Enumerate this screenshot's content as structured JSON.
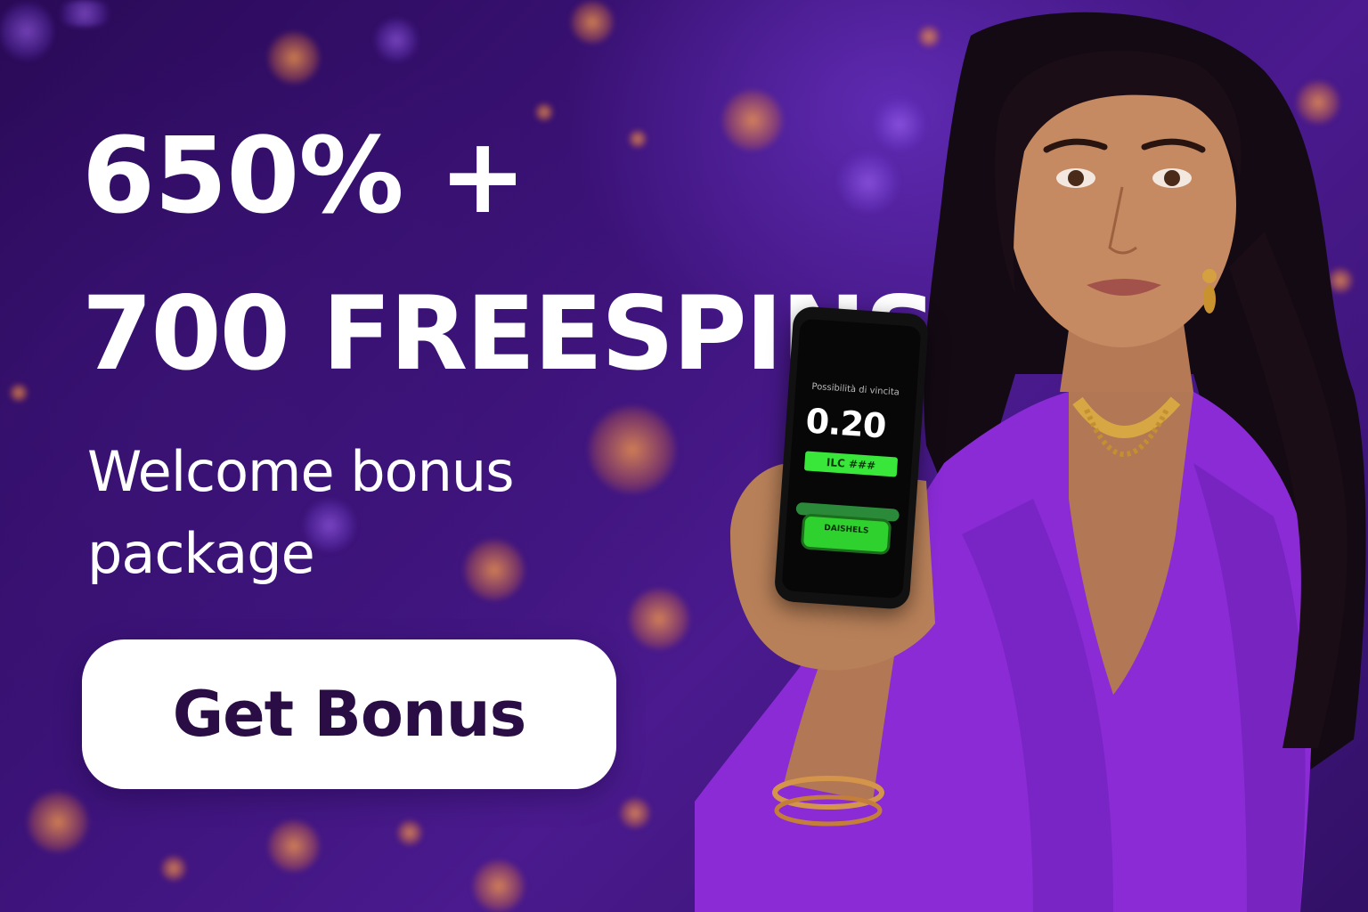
{
  "banner": {
    "headline_line1": "650% +",
    "headline_line2": "700 FREESPINS",
    "subtitle_line1": "Welcome bonus",
    "subtitle_line2": "package",
    "cta_label": "Get Bonus"
  },
  "phone": {
    "small_text": "Possibilità di vincita",
    "value": "0.20",
    "bar_text": "ILC ###",
    "badge_text": "DAISHELS"
  },
  "colors": {
    "background": "#3b1277",
    "cta_background": "#ffffff",
    "cta_text": "#2a0d45",
    "dress": "#8a2bd6",
    "phone_accent": "#39e63a"
  }
}
